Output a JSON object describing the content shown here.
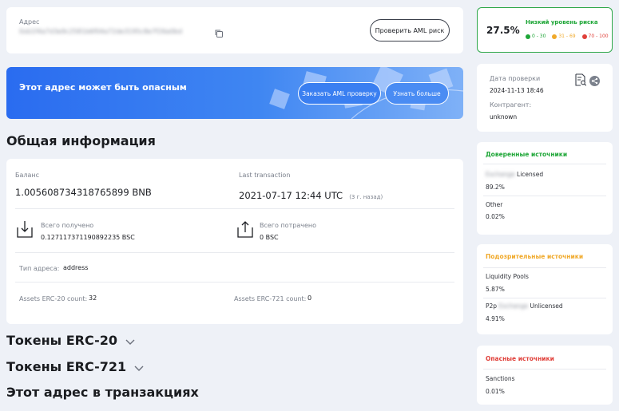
{
  "address": {
    "label": "Адрес",
    "value": "0xb1f4a7d3e9c2581b6f04a72de3195c8e7f26a0bd",
    "check_button": "Проверить AML риск"
  },
  "banner": {
    "text": "Этот адрес может быть опасным",
    "order_button": "Заказать AML проверку",
    "learn_button": "Узнать больше"
  },
  "general": {
    "title": "Общая информация",
    "balance_label": "Баланс",
    "balance_value": "1.005608734318765899 BNB",
    "last_tx_label": "Last transaction",
    "last_tx_value": "2021-07-17 12:44 UTC",
    "last_tx_ago": "(3 г. назад)",
    "received_label": "Всего получено",
    "received_value": "0.127117371190892235 BSC",
    "spent_label": "Всего потрачено",
    "spent_value": "0 BSC",
    "addr_type_label": "Тип адреса:",
    "addr_type_value": "address",
    "erc20_label": "Assets ERC-20 count:",
    "erc20_value": "32",
    "erc721_label": "Assets ERC-721 count:",
    "erc721_value": "0"
  },
  "sections": {
    "erc20": "Токены ERC-20",
    "erc721": "Токены ERC-721",
    "transactions": "Этот адрес в транзакциях"
  },
  "risk": {
    "percent": "27.5%",
    "level": "Низкий уровень риска",
    "low_range": "0 - 30",
    "mid_range": "31 - 69",
    "high_range": "70 - 100",
    "color_low": "#1ea637",
    "color_mid": "#f0a92a",
    "color_high": "#e0403a"
  },
  "check": {
    "date_label": "Дата проверки",
    "date_value": "2024-11-13 18:46",
    "counterparty_label": "Контрагент:",
    "counterparty_value": "unknown"
  },
  "trusted": {
    "title": "Доверенные источники",
    "item1_blur": "Exchange",
    "item1_name": "Licensed",
    "item1_value": "89.2%",
    "item2_name": "Other",
    "item2_value": "0.02%"
  },
  "suspicious": {
    "title": "Подозрительные источники",
    "item1_name": "Liquidity Pools",
    "item1_value": "5.87%",
    "item2_prefix": "P2p",
    "item2_blur": "Exchange",
    "item2_name": "Unlicensed",
    "item2_value": "4.91%"
  },
  "dangerous": {
    "title": "Опасные источники",
    "item1_name": "Sanctions",
    "item1_value": "0.01%"
  }
}
